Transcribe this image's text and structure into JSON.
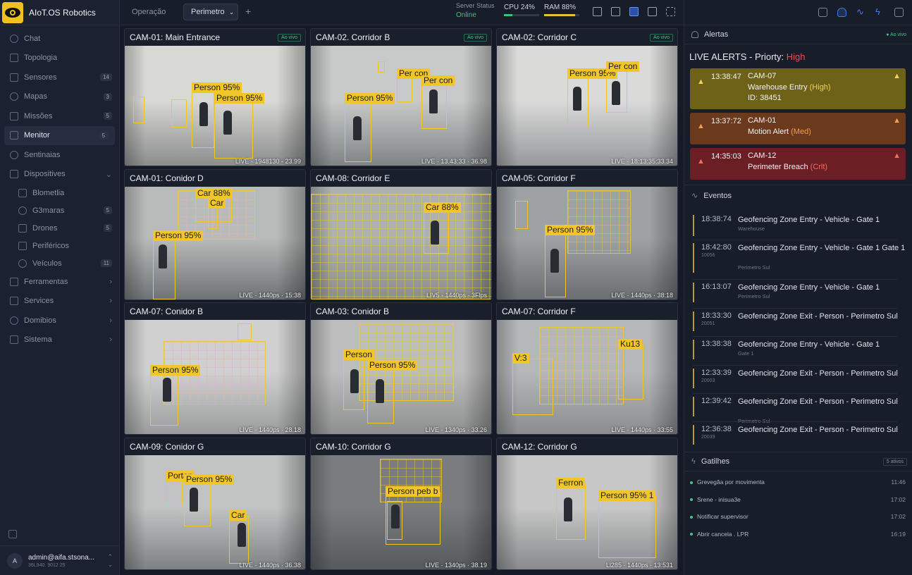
{
  "app": {
    "title": "AIoT.OS Robotics"
  },
  "sidebar": {
    "items": [
      {
        "label": "Chat",
        "icon": "chat-icon"
      },
      {
        "label": "Topologia",
        "icon": "topology-icon"
      },
      {
        "label": "Sensores",
        "icon": "sensor-icon",
        "count": "14"
      },
      {
        "label": "Mapas",
        "icon": "map-icon",
        "count": "3"
      },
      {
        "label": "Missões",
        "icon": "mission-icon",
        "count": "5"
      },
      {
        "label": "Menitor",
        "icon": "monitor-icon",
        "count": "5",
        "active": true
      },
      {
        "label": "Sentinaias",
        "icon": "sentinel-icon"
      },
      {
        "label": "Dispositives",
        "icon": "devices-icon"
      },
      {
        "label": "Blometlia",
        "icon": "biometrics-icon",
        "sub": true
      },
      {
        "label": "G3maras",
        "icon": "camera-icon",
        "count": "5",
        "sub": true
      },
      {
        "label": "Drones",
        "icon": "drone-icon",
        "count": "5",
        "sub": true
      },
      {
        "label": "Periféricos",
        "icon": "peripheral-icon",
        "sub": true
      },
      {
        "label": "Veículos",
        "icon": "vehicle-icon",
        "count": "11",
        "sub": true
      },
      {
        "label": "Ferramentas",
        "icon": "tools-icon",
        "chev": true
      },
      {
        "label": "Services",
        "icon": "services-icon",
        "chev": true
      },
      {
        "label": "Domibios",
        "icon": "domains-icon",
        "chev": true
      },
      {
        "label": "Sistema",
        "icon": "system-icon",
        "chev": true
      }
    ],
    "user": {
      "initial": "A",
      "name": "admin@aifa.stsona...",
      "sub": "36L940. 9012 25"
    }
  },
  "topbar": {
    "tab1": "Operação",
    "tab2": "Perimetro",
    "server_label": "Server Status",
    "server_status": "Online",
    "cpu_label": "CPU 24%",
    "cpu_value": 0.24,
    "ram_label": "RAM 88%",
    "ram_value": 0.88,
    "colors": {
      "cpu": "#3ec27a",
      "ram": "#e8c33a"
    }
  },
  "cameras": [
    {
      "title": "CAM-01: Main Entrance",
      "badge": "Ao vivo",
      "stamp": "LIVE · 1948130 - 23.99",
      "scene": "indoor",
      "labels": [
        "Person 95%",
        "Person 95%"
      ]
    },
    {
      "title": "CAM-02. Corridor B",
      "badge": "Ao vivo",
      "stamp": "LIVE · 13.43:33 · 36.98",
      "scene": "garage",
      "labels": [
        "Person 95%",
        "Per con",
        "Per con"
      ]
    },
    {
      "title": "CAM-02: Corridor C",
      "badge": "Ao vivo",
      "stamp": "LIVE · 18:13:35:33.34",
      "scene": "corridor",
      "labels": [
        "Person 95%",
        "Per con"
      ]
    },
    {
      "title": "CAM-01: Conidor D",
      "badge": "",
      "stamp": "LIVE · 1440ps · 15:38",
      "scene": "garage2",
      "labels": [
        "Car 88%",
        "Car",
        "Person 95%"
      ]
    },
    {
      "title": "CAM-08: Corridor E",
      "badge": "",
      "stamp": "LIV5 · 1440ps · 3Flps",
      "scene": "lot",
      "labels": [
        "Car 88%"
      ]
    },
    {
      "title": "CAM-05: Corridor F",
      "badge": "",
      "stamp": "LIVE · 1440ps · 38:18",
      "scene": "yard",
      "labels": [
        "Person 95%"
      ]
    },
    {
      "title": "CAM-07: Conidor B",
      "badge": "",
      "stamp": "LIVE · 1440ps · 28.18",
      "scene": "hall",
      "labels": [
        "Person 95%"
      ]
    },
    {
      "title": "CAM-03: Conidor B",
      "badge": "",
      "stamp": "LIVE · 1340ps · 33.26",
      "scene": "warehouse",
      "labels": [
        "Person",
        "Person 95%"
      ]
    },
    {
      "title": "CAM-07: Corridor F",
      "badge": "",
      "stamp": "LIVE · 1440ps · 33:55",
      "scene": "lot2",
      "labels": [
        "V:3",
        "Ku13"
      ]
    },
    {
      "title": "CAM-09: Conidor G",
      "badge": "",
      "stamp": "LIVE · 1440ps · 36.38",
      "scene": "garage3",
      "labels": [
        "Portan",
        "Person 95%",
        "Car"
      ]
    },
    {
      "title": "CAM-10: Corridor G",
      "badge": "",
      "stamp": "LIVE · 1340ps · 38.19",
      "scene": "dark",
      "labels": [
        "Person peb b"
      ]
    },
    {
      "title": "CAM-12: Corridor G",
      "badge": "",
      "stamp": "Ll285 · 1440ps · 13:531",
      "scene": "garage4",
      "labels": [
        "Ferron",
        "Person 95% 1"
      ]
    }
  ],
  "alerts": {
    "header": "Alertas",
    "header_right": "● Ao vivo",
    "title_prefix": "LIVE ALERTS - Priorty: ",
    "title_level": "High",
    "items": [
      {
        "time": "13:38:47",
        "cam": "CAM-07",
        "line2": "Warehouse Entry ",
        "level": "(High)",
        "line3": "ID: 38451",
        "color": "#6e6218",
        "levelColor": "#f0d060"
      },
      {
        "time": "13:37:72",
        "cam": "CAM-01",
        "line2": "Motion Alert ",
        "level": "(Med)",
        "line3": "",
        "color": "#6b3a1c",
        "levelColor": "#f0a050"
      },
      {
        "time": "14:35:03",
        "cam": "CAM-12",
        "line2": "Perimeter Breach ",
        "level": "(Crlt)",
        "line3": "",
        "color": "#6b1f24",
        "levelColor": "#f07060"
      }
    ]
  },
  "events": {
    "header": "Eventos",
    "items": [
      {
        "time": "18:38:74",
        "sub": "",
        "desc": "Geofencing Zone Entry - Vehicle - Gate 1",
        "detail": "Warehouse"
      },
      {
        "time": "18:42:80",
        "sub": "10056",
        "desc": "Geofencing Zone Entry - Vehicle - Gate 1 Gate 1",
        "detail": "Perimetro Sul"
      },
      {
        "time": "16:13:07",
        "sub": "",
        "desc": "Geofencing Zone Entry - Vehicle - Gate 1",
        "detail": "Perimetro Sul"
      },
      {
        "time": "18:33:30",
        "sub": "20051",
        "desc": "Geofencing Zone Exit - Person - Perimetro Sul",
        "detail": ""
      },
      {
        "time": "13:38:38",
        "sub": "",
        "desc": "Geofencing Zone Entry - Vehicle - Gate 1",
        "detail": "Gate 1"
      },
      {
        "time": "12:33:39",
        "sub": "20003",
        "desc": "Geofencing Zone Exit - Person - Perimetro Sul",
        "detail": ""
      },
      {
        "time": "12:39:42",
        "sub": "",
        "desc": "Geofencing Zone Exit - Person - Perimetro Sul",
        "detail": "Perimetro Sul"
      },
      {
        "time": "12:36:38",
        "sub": "20039",
        "desc": "Geofencing Zone Exit - Person - Perimetro Sul",
        "detail": ""
      }
    ]
  },
  "triggers": {
    "header": "Gatilhes",
    "count": "5 ativos",
    "items": [
      {
        "label": "Grevegãa por movimenta",
        "time": "11:46"
      },
      {
        "label": "Srene - inisua3e",
        "time": "17:02"
      },
      {
        "label": "Notificar supervisor",
        "time": "17:02"
      },
      {
        "label": "Abrir cancela . LPR",
        "time": "16:19"
      }
    ]
  }
}
